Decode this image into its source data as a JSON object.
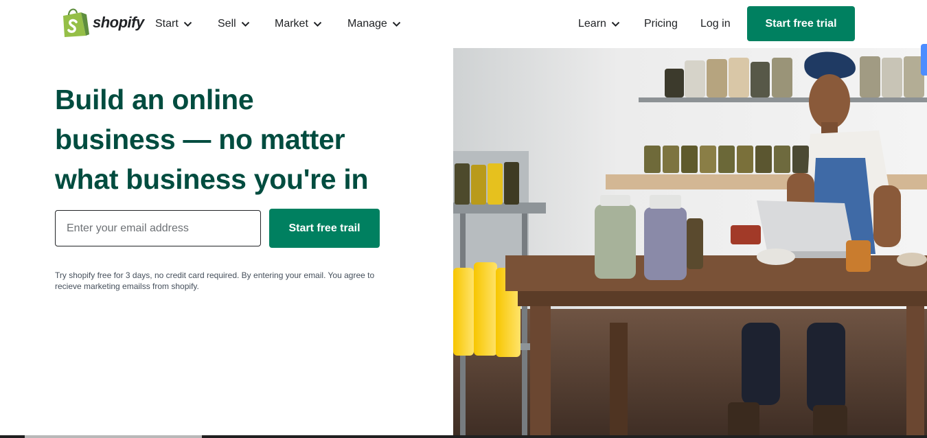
{
  "header": {
    "logo_text": "shopify",
    "logo_icon": "shopping-bag-icon",
    "nav_left": [
      {
        "label": "Start",
        "icon": "chevron-down-icon"
      },
      {
        "label": "Sell",
        "icon": "chevron-down-icon"
      },
      {
        "label": "Market",
        "icon": "chevron-down-icon"
      },
      {
        "label": "Manage",
        "icon": "chevron-down-icon"
      }
    ],
    "nav_right": {
      "learn": {
        "label": "Learn",
        "icon": "chevron-down-icon"
      },
      "pricing": "Pricing",
      "login": "Log in",
      "cta": "Start free trial"
    }
  },
  "hero": {
    "headline_line1": "Build an online",
    "headline_line2": "business — no matter",
    "headline_line3": "what business you're in",
    "email_placeholder": "Enter your email address",
    "email_value": "",
    "cta": "Start free trail",
    "disclaimer": "Try shopify free for 3 days, no credit card required. By entering your email. You agree to recieve marketing emailss from shopify."
  },
  "colors": {
    "brand_green": "#008060",
    "headline_green": "#004c3f",
    "logo_green": "#95bf47",
    "text_dark": "#212326"
  }
}
